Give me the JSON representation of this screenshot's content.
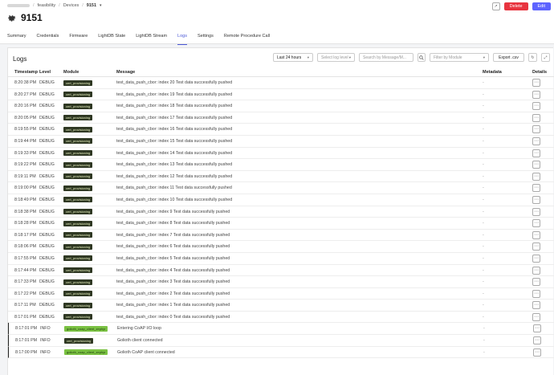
{
  "breadcrumb": {
    "project": "feasibility",
    "section": "Devices",
    "device": "9151"
  },
  "header": {
    "title": "9151",
    "delete_label": "Delete",
    "edit_label": "Edit"
  },
  "tabs": [
    {
      "label": "Summary"
    },
    {
      "label": "Credentials"
    },
    {
      "label": "Firmware"
    },
    {
      "label": "LightDB State"
    },
    {
      "label": "LightDB Stream"
    },
    {
      "label": "Logs",
      "active": true
    },
    {
      "label": "Settings"
    },
    {
      "label": "Remote Procedure Call"
    }
  ],
  "logs": {
    "title": "Logs",
    "filters": {
      "range": "Last 24 hours",
      "level_placeholder": "Select log level",
      "search_placeholder": "Search by Message/M...",
      "module_placeholder": "Filter by Module",
      "export_label": "Export .csv"
    },
    "columns": {
      "timestamp": "Timestamp",
      "level": "Level",
      "module": "Module",
      "message": "Message",
      "metadata": "Metadata",
      "details": "Details"
    },
    "rows": [
      {
        "time": "8:20:38 PM",
        "level": "DEBUG",
        "module": "cert_provisioning",
        "message": "test_data_push_cbor: index 20 Test data successfully pushed",
        "metadata": "-"
      },
      {
        "time": "8:20:27 PM",
        "level": "DEBUG",
        "module": "cert_provisioning",
        "message": "test_data_push_cbor: index 19 Test data successfully pushed",
        "metadata": "-"
      },
      {
        "time": "8:20:16 PM",
        "level": "DEBUG",
        "module": "cert_provisioning",
        "message": "test_data_push_cbor: index 18 Test data successfully pushed",
        "metadata": "-"
      },
      {
        "time": "8:20:05 PM",
        "level": "DEBUG",
        "module": "cert_provisioning",
        "message": "test_data_push_cbor: index 17 Test data successfully pushed",
        "metadata": "-"
      },
      {
        "time": "8:19:55 PM",
        "level": "DEBUG",
        "module": "cert_provisioning",
        "message": "test_data_push_cbor: index 16 Test data successfully pushed",
        "metadata": "-"
      },
      {
        "time": "8:19:44 PM",
        "level": "DEBUG",
        "module": "cert_provisioning",
        "message": "test_data_push_cbor: index 15 Test data successfully pushed",
        "metadata": "-"
      },
      {
        "time": "8:19:33 PM",
        "level": "DEBUG",
        "module": "cert_provisioning",
        "message": "test_data_push_cbor: index 14 Test data successfully pushed",
        "metadata": "-"
      },
      {
        "time": "8:19:22 PM",
        "level": "DEBUG",
        "module": "cert_provisioning",
        "message": "test_data_push_cbor: index 13 Test data successfully pushed",
        "metadata": "-"
      },
      {
        "time": "8:19:11 PM",
        "level": "DEBUG",
        "module": "cert_provisioning",
        "message": "test_data_push_cbor: index 12 Test data successfully pushed",
        "metadata": "-"
      },
      {
        "time": "8:19:00 PM",
        "level": "DEBUG",
        "module": "cert_provisioning",
        "message": "test_data_push_cbor: index 11 Test data successfully pushed",
        "metadata": "-"
      },
      {
        "time": "8:18:49 PM",
        "level": "DEBUG",
        "module": "cert_provisioning",
        "message": "test_data_push_cbor: index 10 Test data successfully pushed",
        "metadata": "-"
      },
      {
        "time": "8:18:38 PM",
        "level": "DEBUG",
        "module": "cert_provisioning",
        "message": "test_data_push_cbor: index 9 Test data successfully pushed",
        "metadata": "-"
      },
      {
        "time": "8:18:28 PM",
        "level": "DEBUG",
        "module": "cert_provisioning",
        "message": "test_data_push_cbor: index 8 Test data successfully pushed",
        "metadata": "-"
      },
      {
        "time": "8:18:17 PM",
        "level": "DEBUG",
        "module": "cert_provisioning",
        "message": "test_data_push_cbor: index 7 Test data successfully pushed",
        "metadata": "-"
      },
      {
        "time": "8:18:06 PM",
        "level": "DEBUG",
        "module": "cert_provisioning",
        "message": "test_data_push_cbor: index 6 Test data successfully pushed",
        "metadata": "-"
      },
      {
        "time": "8:17:55 PM",
        "level": "DEBUG",
        "module": "cert_provisioning",
        "message": "test_data_push_cbor: index 5 Test data successfully pushed",
        "metadata": "-"
      },
      {
        "time": "8:17:44 PM",
        "level": "DEBUG",
        "module": "cert_provisioning",
        "message": "test_data_push_cbor: index 4 Test data successfully pushed",
        "metadata": "-"
      },
      {
        "time": "8:17:33 PM",
        "level": "DEBUG",
        "module": "cert_provisioning",
        "message": "test_data_push_cbor: index 3 Test data successfully pushed",
        "metadata": "-"
      },
      {
        "time": "8:17:22 PM",
        "level": "DEBUG",
        "module": "cert_provisioning",
        "message": "test_data_push_cbor: index 2 Test data successfully pushed",
        "metadata": "-"
      },
      {
        "time": "8:17:11 PM",
        "level": "DEBUG",
        "module": "cert_provisioning",
        "message": "test_data_push_cbor: index 1 Test data successfully pushed",
        "metadata": "-"
      },
      {
        "time": "8:17:01 PM",
        "level": "DEBUG",
        "module": "cert_provisioning",
        "message": "test_data_push_cbor: index 0 Test data successfully pushed",
        "metadata": "-"
      },
      {
        "time": "8:17:01 PM",
        "level": "INFO",
        "module": "golioth_coap_client_zephyr",
        "message": "Entering CoAP I/O loop",
        "metadata": "-"
      },
      {
        "time": "8:17:01 PM",
        "level": "INFO",
        "module": "cert_provisioning",
        "message": "Golioth client connected",
        "metadata": "-"
      },
      {
        "time": "8:17:00 PM",
        "level": "INFO",
        "module": "golioth_coap_client_zephyr",
        "message": "Golioth CoAP client connected",
        "metadata": "-"
      }
    ]
  },
  "icons": {
    "device": "gear-icon",
    "search": "search-icon",
    "refresh": "refresh-icon",
    "fullscreen": "fullscreen-icon",
    "details": "more-dots-icon"
  },
  "colors": {
    "accent": "#4a58d6",
    "delete": "#e8343f",
    "edit": "#5d63ff",
    "module_tag": "#2f3823",
    "module_tag_green": "#7ac142"
  }
}
